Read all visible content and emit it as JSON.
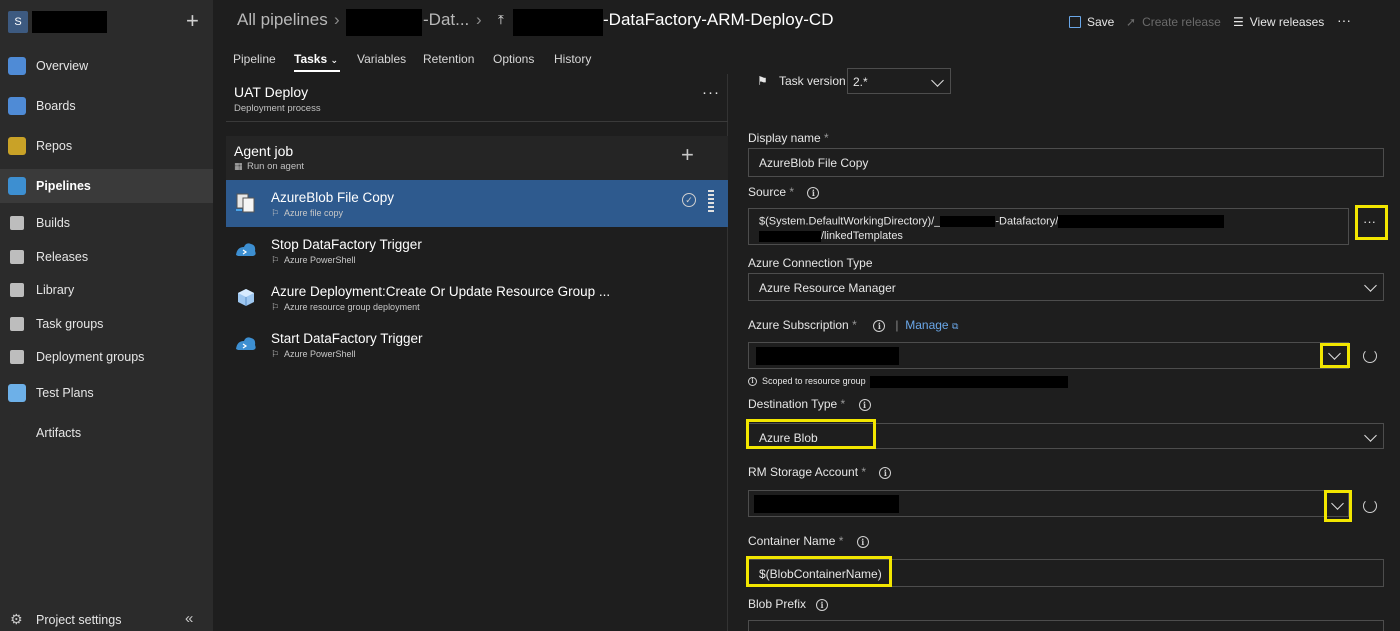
{
  "org": {
    "avatar_letter": "S"
  },
  "nav": {
    "items": [
      {
        "label": "Overview",
        "icon": "overview-icon",
        "color": "#4f8bd6"
      },
      {
        "label": "Boards",
        "icon": "boards-icon",
        "color": "#4f8bd6"
      },
      {
        "label": "Repos",
        "icon": "repos-icon",
        "color": "#c9a227"
      },
      {
        "label": "Pipelines",
        "icon": "pipelines-icon",
        "color": "#3d8fd1"
      },
      {
        "label": "Builds",
        "icon": "builds-icon",
        "color": "#d0d0d0"
      },
      {
        "label": "Releases",
        "icon": "releases-icon",
        "color": "#d0d0d0"
      },
      {
        "label": "Library",
        "icon": "library-icon",
        "color": "#d0d0d0"
      },
      {
        "label": "Task groups",
        "icon": "task-groups-icon",
        "color": "#d0d0d0"
      },
      {
        "label": "Deployment groups",
        "icon": "deployment-groups-icon",
        "color": "#d0d0d0"
      },
      {
        "label": "Test Plans",
        "icon": "test-plans-icon",
        "color": "#6db0e8"
      },
      {
        "label": "Artifacts",
        "icon": "artifacts-icon",
        "color": "#c33b6e"
      }
    ],
    "active": "Pipelines",
    "project_settings": "Project settings"
  },
  "header": {
    "crumb1": "All pipelines",
    "crumb2_suffix": "-Dat...",
    "crumb3_suffix": "-DataFactory-ARM-Deploy-CD",
    "save": "Save",
    "create_release": "Create release",
    "view_releases": "View releases",
    "more": "···"
  },
  "tabs": [
    "Pipeline",
    "Tasks",
    "Variables",
    "Retention",
    "Options",
    "History"
  ],
  "active_tab": "Tasks",
  "stage": {
    "title": "UAT Deploy",
    "subtitle": "Deployment process",
    "more": "···"
  },
  "agent_job": {
    "title": "Agent job",
    "subtitle": "Run on agent"
  },
  "tasks": [
    {
      "name": "AzureBlob File Copy",
      "subtitle": "Azure file copy",
      "selected": true
    },
    {
      "name": "Stop DataFactory Trigger",
      "subtitle": "Azure PowerShell",
      "selected": false
    },
    {
      "name": "Azure Deployment:Create Or Update Resource Group ...",
      "subtitle": "Azure resource group deployment",
      "selected": false
    },
    {
      "name": "Start DataFactory Trigger",
      "subtitle": "Azure PowerShell",
      "selected": false
    }
  ],
  "details": {
    "task_version_label": "Task version",
    "task_version_value": "2.*",
    "display_name_label": "Display name",
    "display_name_value": "AzureBlob File Copy",
    "source_label": "Source",
    "source_line1_a": "$(System.DefaultWorkingDirectory)/_",
    "source_line1_b": "-Datafactory/",
    "source_line2": "/linkedTemplates",
    "source_browse": "···",
    "conn_type_label": "Azure Connection Type",
    "conn_type_value": "Azure Resource Manager",
    "subscription_label": "Azure Subscription",
    "manage_link": "Manage",
    "scoped_text": "Scoped to resource group",
    "dest_type_label": "Destination Type",
    "dest_type_value": "Azure Blob",
    "storage_label": "RM Storage Account",
    "container_label": "Container Name",
    "container_value": "$(BlobContainerName)",
    "blob_prefix_label": "Blob Prefix",
    "required_mark": "*",
    "highlight_color": "#f2e600"
  }
}
